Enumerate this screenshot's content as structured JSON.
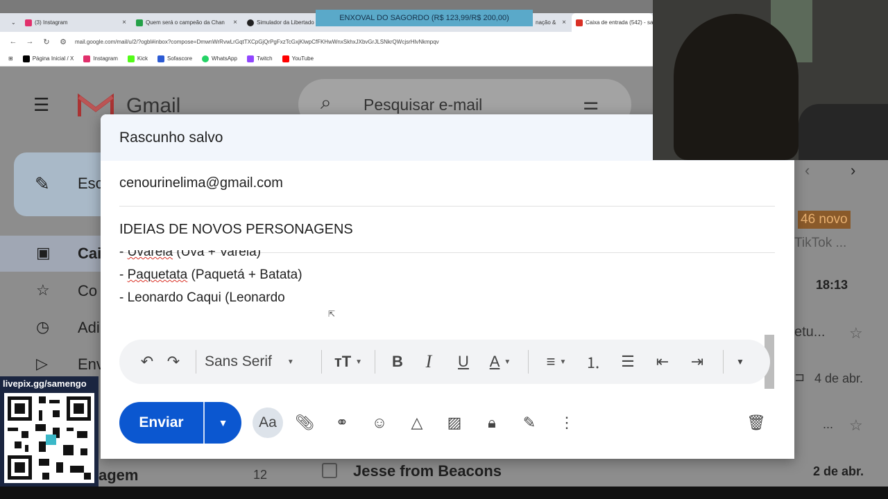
{
  "browser": {
    "tabs": [
      {
        "label": "(3) Instagram",
        "color": "#e1306c"
      },
      {
        "label": "Quem será o campeão da Chan",
        "color": "#24a148"
      },
      {
        "label": "Simulador da Libertado",
        "color": "#222222"
      },
      {
        "label": "nação &",
        "color": "#cccccc"
      },
      {
        "label": "Caixa de entrada (542) - sa",
        "color": "#d93025",
        "active": true
      }
    ],
    "banner": "ENXOVAL DO SAGORDO (R$ 123,99/R$ 200,00)",
    "url": "mail.google.com/mail/u/2/?ogbl#inbox?compose=DmwnWrRvwLrGqtTXCpGjQrPgFxzTcGxjKlwpCfFKHwWnxSkhxJXbvGrJLSNkrQWcjsrHlvNkmpqv",
    "bookmarks": [
      {
        "label": "Página Inicial / X",
        "color": "#000000"
      },
      {
        "label": "Instagram",
        "color": "#e1306c"
      },
      {
        "label": "Kick",
        "color": "#53fc18"
      },
      {
        "label": "Sofascore",
        "color": "#2c5bd4"
      },
      {
        "label": "WhatsApp",
        "color": "#25d366"
      },
      {
        "label": "Twitch",
        "color": "#9146ff"
      },
      {
        "label": "YouTube",
        "color": "#ff0000"
      }
    ]
  },
  "gmail": {
    "logo_text": "Gmail",
    "search_placeholder": "Pesquisar e-mail",
    "compose_label": "Esc",
    "nav": [
      {
        "label": "Cai",
        "icon": "inbox-icon"
      },
      {
        "label": "Co",
        "icon": "star-icon"
      },
      {
        "label": "Adi",
        "icon": "clock-icon"
      },
      {
        "label": "Env",
        "icon": "send-icon"
      }
    ],
    "nav_bottom": {
      "label": "agem",
      "count": "12"
    },
    "right_panel": {
      "badge": "46 novo",
      "snippet1": "TikTok ...",
      "time1": "18:13",
      "snippet2": "etu...",
      "date2": "4 de abr.",
      "snippet3": "...",
      "sender": "Jesse from Beacons",
      "date3": "2 de abr."
    }
  },
  "compose": {
    "title": "Rascunho salvo",
    "recipient": "cenourinelima@gmail.com",
    "subject": "IDEIAS DE NOVOS PERSONAGENS",
    "body_lines": [
      {
        "prefix": "- ",
        "word": "Uvarela",
        "rest": " (Uva + Varela)"
      },
      {
        "prefix": "- ",
        "word": "Paquetata",
        "rest": " (Paquetá + Batata)"
      },
      {
        "prefix": "- ",
        "word": "Leonardo Caqui (Leonardo",
        "rest": ""
      }
    ],
    "font_name": "Sans Serif",
    "send_label": "Enviar",
    "format_label": "Aa"
  },
  "overlay": {
    "qr_label": "livepix.gg/samengo"
  }
}
